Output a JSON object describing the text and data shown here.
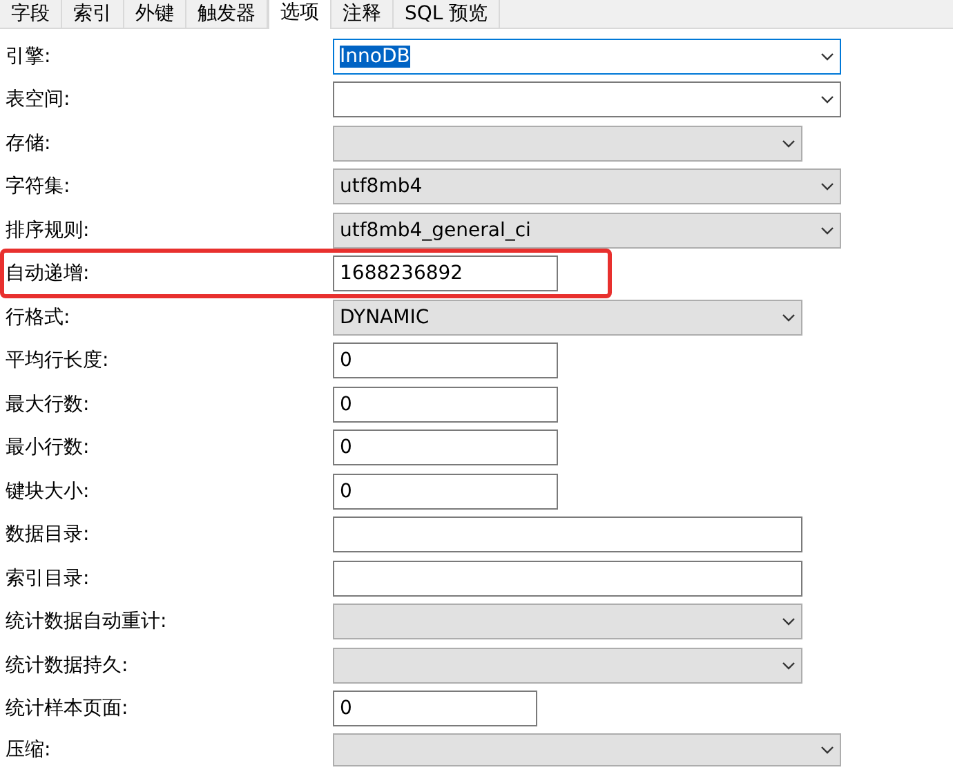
{
  "tabs": [
    {
      "label": "字段",
      "selected": false
    },
    {
      "label": "索引",
      "selected": false
    },
    {
      "label": "外键",
      "selected": false
    },
    {
      "label": "触发器",
      "selected": false
    },
    {
      "label": "选项",
      "selected": true
    },
    {
      "label": "注释",
      "selected": false
    },
    {
      "label": "SQL 预览",
      "selected": false
    }
  ],
  "fields": [
    {
      "label": "引擎:",
      "kind": "combo",
      "editable": true,
      "focused": true,
      "text_selected": true,
      "value": "InnoDB"
    },
    {
      "label": "表空间:",
      "kind": "combo",
      "editable": true
    },
    {
      "label": "存储:",
      "kind": "combo",
      "editable": false
    },
    {
      "label": "字符集:",
      "kind": "combo",
      "editable": false,
      "value": "utf8mb4"
    },
    {
      "label": "排序规则:",
      "kind": "combo",
      "editable": false,
      "value": "utf8mb4_general_ci"
    },
    {
      "label": "自动递增:",
      "kind": "text",
      "highlighted": true,
      "value": "1688236892"
    },
    {
      "label": "行格式:",
      "kind": "combo",
      "editable": false,
      "value": "DYNAMIC"
    },
    {
      "label": "平均行长度:",
      "kind": "text",
      "value": "0"
    },
    {
      "label": "最大行数:",
      "kind": "text",
      "value": "0"
    },
    {
      "label": "最小行数:",
      "kind": "text",
      "value": "0"
    },
    {
      "label": "键块大小:",
      "kind": "text",
      "value": "0"
    },
    {
      "label": "数据目录:",
      "kind": "text"
    },
    {
      "label": "索引目录:",
      "kind": "text"
    },
    {
      "label": "统计数据自动重计:",
      "kind": "combo",
      "editable": false
    },
    {
      "label": "统计数据持久:",
      "kind": "combo",
      "editable": false
    },
    {
      "label": "统计样本页面:",
      "kind": "text",
      "value": "0"
    },
    {
      "label": "压缩:",
      "kind": "combo",
      "editable": false
    }
  ]
}
